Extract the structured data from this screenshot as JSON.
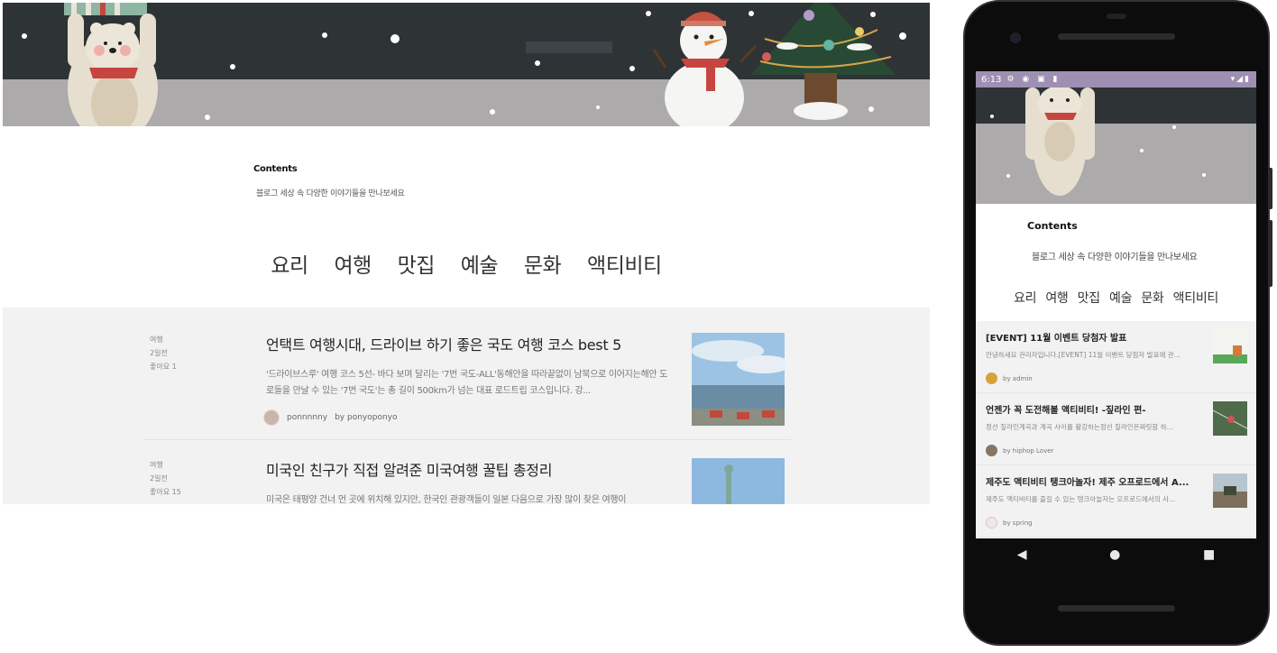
{
  "desktop": {
    "contents_title": "Contents",
    "contents_subtitle": "블로그 세상 속 다양한 이야기들을 만나보세요",
    "categories": [
      "요리",
      "여행",
      "맛집",
      "예술",
      "문화",
      "액티비티"
    ],
    "posts": [
      {
        "category": "여행",
        "time": "2일전",
        "likes": "좋아요 1",
        "title": "언택트 여행시대, 드라이브 하기 좋은 국도 여행 코스 best 5",
        "desc": "'드라이브스루' 여행 코스 5선- 바다 보며 달리는 '7번 국도-ALL'동해안을 따라끝없이 남북으로 이어지는해안 도로들을 만날 수 있는 '7번 국도'는 총 길이 500km가 넘는 대표 로드트립 코스입니다. 강...",
        "author": "ponnnnny",
        "by": "by ponyoponyo"
      },
      {
        "category": "여행",
        "time": "2일전",
        "likes": "좋아요 15",
        "title": "미국인 친구가 직접 알려준 미국여행 꿀팁 총정리",
        "desc": "미국은 태평양 건너 먼 곳에 위치해 있지만, 한국인 관광객들이 일본 다음으로 가장 많이 찾은 여행이"
      }
    ]
  },
  "mobile": {
    "status": {
      "time": "6:13"
    },
    "contents_title": "Contents",
    "contents_subtitle": "블로그 세상 속 다양한 이야기들을 만나보세요",
    "categories": [
      "요리",
      "여행",
      "맛집",
      "예술",
      "문화",
      "액티비티"
    ],
    "posts": [
      {
        "title": "[EVENT] 11월 이벤트 당첨자 발표",
        "desc": "안녕하세요 관리자입니다.[EVENT] 11월 이벤트 당첨자 발표에 관...",
        "by": "by admin"
      },
      {
        "title": "언젠가 꼭 도전해볼 액티비티! -짚라인 편-",
        "desc": "정선 짚라인계곡과 계곡 사이를 활강하는정선 짚라인은짜릿함 하...",
        "by": "by hiphop Lover"
      },
      {
        "title": "제주도 액티비티 탱크아놀자! 제주 오프로드에서 A...",
        "desc": "제주도 액티비티를 즐길 수 있는 탱크아놀자는 오프로드에서의 사...",
        "by": "by spring"
      }
    ]
  },
  "colors": {
    "banner_dark": "#2e3336",
    "banner_floor": "#acaaab",
    "list_bg": "#f2f2f2",
    "status_bar": "#9f8fb2",
    "phone_body": "#0c0c0c"
  }
}
